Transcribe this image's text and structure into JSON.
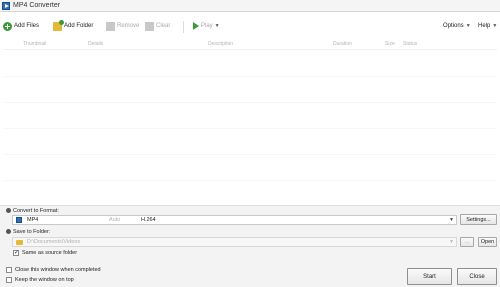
{
  "window": {
    "title": "MP4 Converter"
  },
  "toolbar": {
    "add_files": "Add Files",
    "add_folder": "Add Folder",
    "remove": "Remove",
    "clear": "Clear",
    "play": "Play",
    "options": "Options",
    "help": "Help"
  },
  "list": {
    "columns": [
      "Thumbnail",
      "Details",
      "Description",
      "Duration",
      "Size",
      "Status"
    ],
    "rows": []
  },
  "convert": {
    "label": "Convert to Format:",
    "format_value": "MP4",
    "sub_value": "Auto",
    "codec_value": "H.264",
    "settings_button": "Settings..."
  },
  "save": {
    "label": "Save to Folder:",
    "path_value": "D:\\Documents\\Videos",
    "browse_button": "...",
    "open_button": "Open",
    "same_as_source_label": "Same as source folder",
    "same_as_source_checked": true
  },
  "footer": {
    "close_when_completed_label": "Close this window when completed",
    "close_when_completed_checked": false,
    "keep_on_top_label": "Keep the window on top",
    "keep_on_top_checked": false,
    "start_button": "Start",
    "close_button": "Close"
  }
}
